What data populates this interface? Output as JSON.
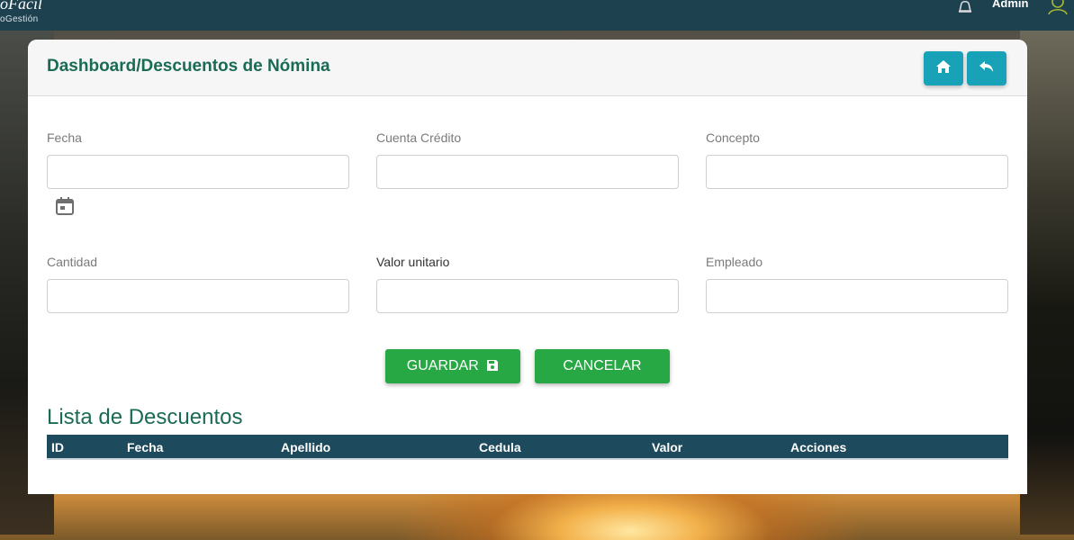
{
  "topbar": {
    "brand": "oFácil",
    "brand_sub": "oGestión",
    "user": "Admin",
    "icons": [
      "bell-icon",
      "user-icon"
    ]
  },
  "header": {
    "title": "Dashboard/Descuentos de Nómina",
    "buttons": [
      {
        "name": "home",
        "icon": "home-icon"
      },
      {
        "name": "back",
        "icon": "reply-icon"
      }
    ]
  },
  "form": {
    "fecha": {
      "label": "Fecha",
      "value": ""
    },
    "cuenta_credito": {
      "label": "Cuenta Crédito",
      "value": ""
    },
    "concepto": {
      "label": "Concepto",
      "value": ""
    },
    "cantidad": {
      "label": "Cantidad",
      "value": ""
    },
    "valor_unitario": {
      "label": "Valor unitario",
      "value": ""
    },
    "empleado": {
      "label": "Empleado",
      "value": ""
    }
  },
  "actions": {
    "save_label": "GUARDAR",
    "cancel_label": "CANCELAR"
  },
  "list": {
    "title": "Lista de Descuentos",
    "columns": [
      "ID",
      "Fecha",
      "Apellido",
      "Cedula",
      "Valor",
      "Acciones"
    ],
    "rows": []
  },
  "colors": {
    "topbar": "#1e4150",
    "accent_green": "#28a745",
    "accent_teal": "#17a2b8",
    "title_green": "#1a6b55",
    "table_header": "#1d4a5d"
  }
}
